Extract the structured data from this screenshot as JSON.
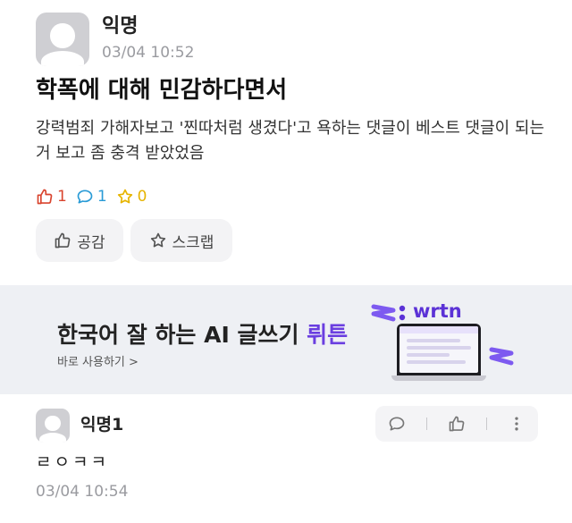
{
  "post": {
    "author": "익명",
    "date": "03/04 10:52",
    "title": "학폭에 대해 민감하다면서",
    "body": "강력범죄 가해자보고 '찐따처럼 생겼다'고 욕하는 댓글이 베스트 댓글이 되는 거 보고 좀 충격 받았었음",
    "stats": {
      "likes": "1",
      "comments": "1",
      "scraps": "0"
    },
    "buttons": {
      "like_label": "공감",
      "scrap_label": "스크랩"
    }
  },
  "banner": {
    "title_main": "한국어 잘 하는 AI 글쓰기 ",
    "title_accent": "뤼튼",
    "subtitle": "바로 사용하기 >",
    "brand": "wrtn"
  },
  "comment": {
    "author": "익명1",
    "text": "ㄹㅇㅋㅋ",
    "date": "03/04 10:54"
  },
  "colors": {
    "like": "#d9442e",
    "comment": "#2a9bd6",
    "scrap": "#e6b400",
    "brand": "#6a3ee0",
    "meta_gray": "#9a9ba0"
  },
  "icons": [
    "thumbs-up-icon",
    "speech-bubble-icon",
    "star-icon",
    "more-vertical-icon"
  ]
}
